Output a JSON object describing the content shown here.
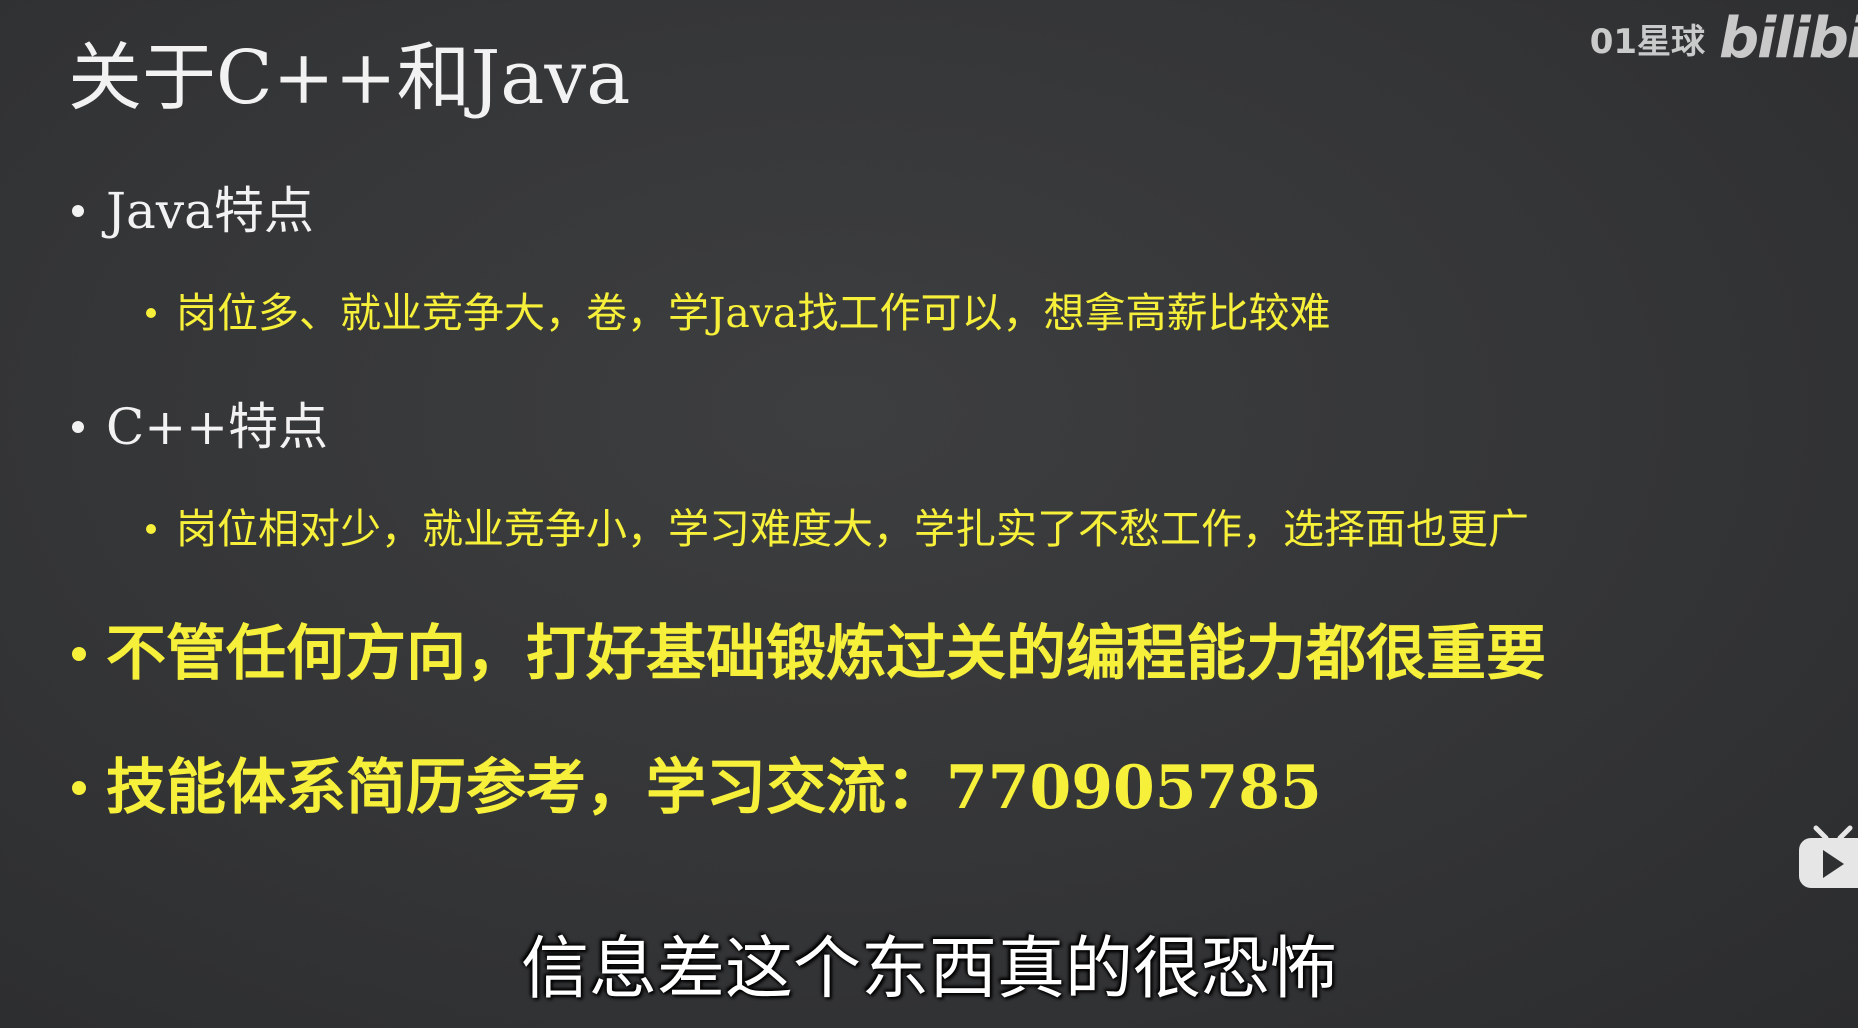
{
  "watermark": {
    "channel": "01星球",
    "logo": "bilibi"
  },
  "slide": {
    "title": "关于C++和Java",
    "java": {
      "heading": "Java特点",
      "detail": "岗位多、就业竞争大，卷，学Java找工作可以，想拿高薪比较难"
    },
    "cpp": {
      "heading": "C++特点",
      "detail": "岗位相对少，就业竞争小，学习难度大，学扎实了不愁工作，选择面也更广"
    },
    "point_foundation": "不管任何方向，打好基础锻炼过关的编程能力都很重要",
    "point_contact": "技能体系简历参考，学习交流：770905785"
  },
  "subtitle": "信息差这个东西真的很恐怖",
  "icons": {
    "player": "play-icon"
  },
  "colors": {
    "background": "#353638",
    "text_white": "#f2f2f2",
    "text_yellow": "#f7f03a"
  }
}
